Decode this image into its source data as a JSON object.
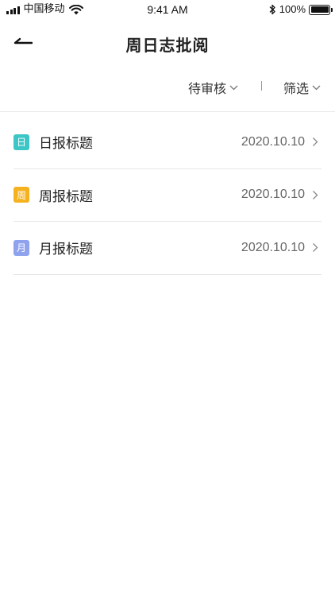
{
  "status_bar": {
    "carrier": "中国移动",
    "time": "9:41 AM",
    "battery": "100%",
    "battery_level": 1.0
  },
  "nav": {
    "title": "周日志批阅",
    "back_icon": "back-arrow-icon"
  },
  "filters": {
    "status_label": "待审核",
    "filter_label": "筛选"
  },
  "reports": [
    {
      "badge": "日",
      "badge_color": "#3cc6c6",
      "title": "日报标题",
      "date": "2020.10.10"
    },
    {
      "badge": "周",
      "badge_color": "#f5b21e",
      "title": "周报标题",
      "date": "2020.10.10"
    },
    {
      "badge": "月",
      "badge_color": "#8fa2ee",
      "title": "月报标题",
      "date": "2020.10.10"
    }
  ],
  "colors": {
    "daily": "#3cc6c6",
    "weekly": "#f5b21e",
    "monthly": "#8fa2ee",
    "divider": "#e6e6e6"
  }
}
